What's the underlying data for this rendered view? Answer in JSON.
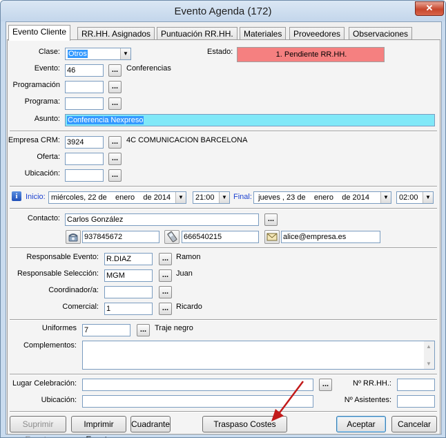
{
  "window": {
    "title": "Evento Agenda (172)",
    "close_glyph": "✕"
  },
  "tabs": [
    {
      "label": "Evento Cliente"
    },
    {
      "label": "RR.HH. Asignados"
    },
    {
      "label": "Puntuación RR.HH."
    },
    {
      "label": "Materiales"
    },
    {
      "label": "Proveedores"
    },
    {
      "label": "Observaciones"
    }
  ],
  "general": {
    "clase_label": "Clase:",
    "clase_value": "Otros",
    "estado_label": "Estado:",
    "estado_value": "1. Pendiente RR.HH.",
    "estado_color": "#f58080",
    "evento_label": "Evento:",
    "evento_value": "46",
    "evento_desc": "Conferencias",
    "programacion_label": "Programación",
    "programacion_value": "",
    "programa_label": "Programa:",
    "programa_value": "",
    "asunto_label": "Asunto:",
    "asunto_value": "Conferencia Nexpreso",
    "asunto_color": "#80e8f8"
  },
  "empresa": {
    "empresa_label": "Empresa CRM:",
    "empresa_value": "3924",
    "empresa_desc": "4C COMUNICACION BARCELONA",
    "oferta_label": "Oferta:",
    "oferta_value": "",
    "ubicacion_label": "Ubicación:",
    "ubicacion_value": ""
  },
  "fechas": {
    "info_glyph": "i",
    "inicio_label": "Inicio:",
    "inicio_dow": "miércoles",
    "inicio_day": "22",
    "inicio_month": "enero",
    "inicio_year": "2014",
    "inicio_de1": "de",
    "inicio_de2": "de",
    "inicio_hora": "21:00",
    "final_label": "Final:",
    "final_dow": "jueves",
    "final_day": "23",
    "final_month": "enero",
    "final_year": "2014",
    "final_de1": "de",
    "final_de2": "de",
    "final_hora": "02:00",
    "accent": "#1a3fd0"
  },
  "contacto": {
    "label": "Contacto:",
    "name": "Carlos González",
    "phone": "937845672",
    "mobile": "666540215",
    "email": "alice@empresa.es",
    "phone_icon": "phone-icon",
    "mobile_icon": "mobile-icon",
    "email_icon": "envelope-icon"
  },
  "responsables": {
    "resp_evento_label": "Responsable Evento:",
    "resp_evento_value": "R.DIAZ",
    "resp_evento_desc": "Ramon",
    "resp_sel_label": "Responsable Selección:",
    "resp_sel_value": "MGM",
    "resp_sel_desc": "Juan",
    "coord_label": "Coordinador/a:",
    "coord_value": "",
    "comercial_label": "Comercial:",
    "comercial_value": "1",
    "comercial_desc": "Ricardo"
  },
  "vestuario": {
    "uniformes_label": "Uniformes",
    "uniformes_value": "7",
    "uniformes_desc": "Traje negro",
    "complementos_label": "Complementos:",
    "complementos_value": ""
  },
  "lugar": {
    "lugar_label": "Lugar Celebración:",
    "lugar_value": "",
    "ubicacion_label": "Ubicación:",
    "ubicacion_value": "",
    "nrrhh_label": "Nº RR.HH.:",
    "nrrhh_value": "",
    "nasist_label": "Nº Asistentes:",
    "nasist_value": ""
  },
  "buttons": {
    "suprimir": "Suprimir Evento",
    "imprimir": "Imprimir Evento",
    "cuadrante": "Cuadrante",
    "traspaso": "Traspaso Costes",
    "aceptar": "Aceptar",
    "cancelar": "Cancelar"
  },
  "dots": "...",
  "dropdown_glyph": "▼"
}
